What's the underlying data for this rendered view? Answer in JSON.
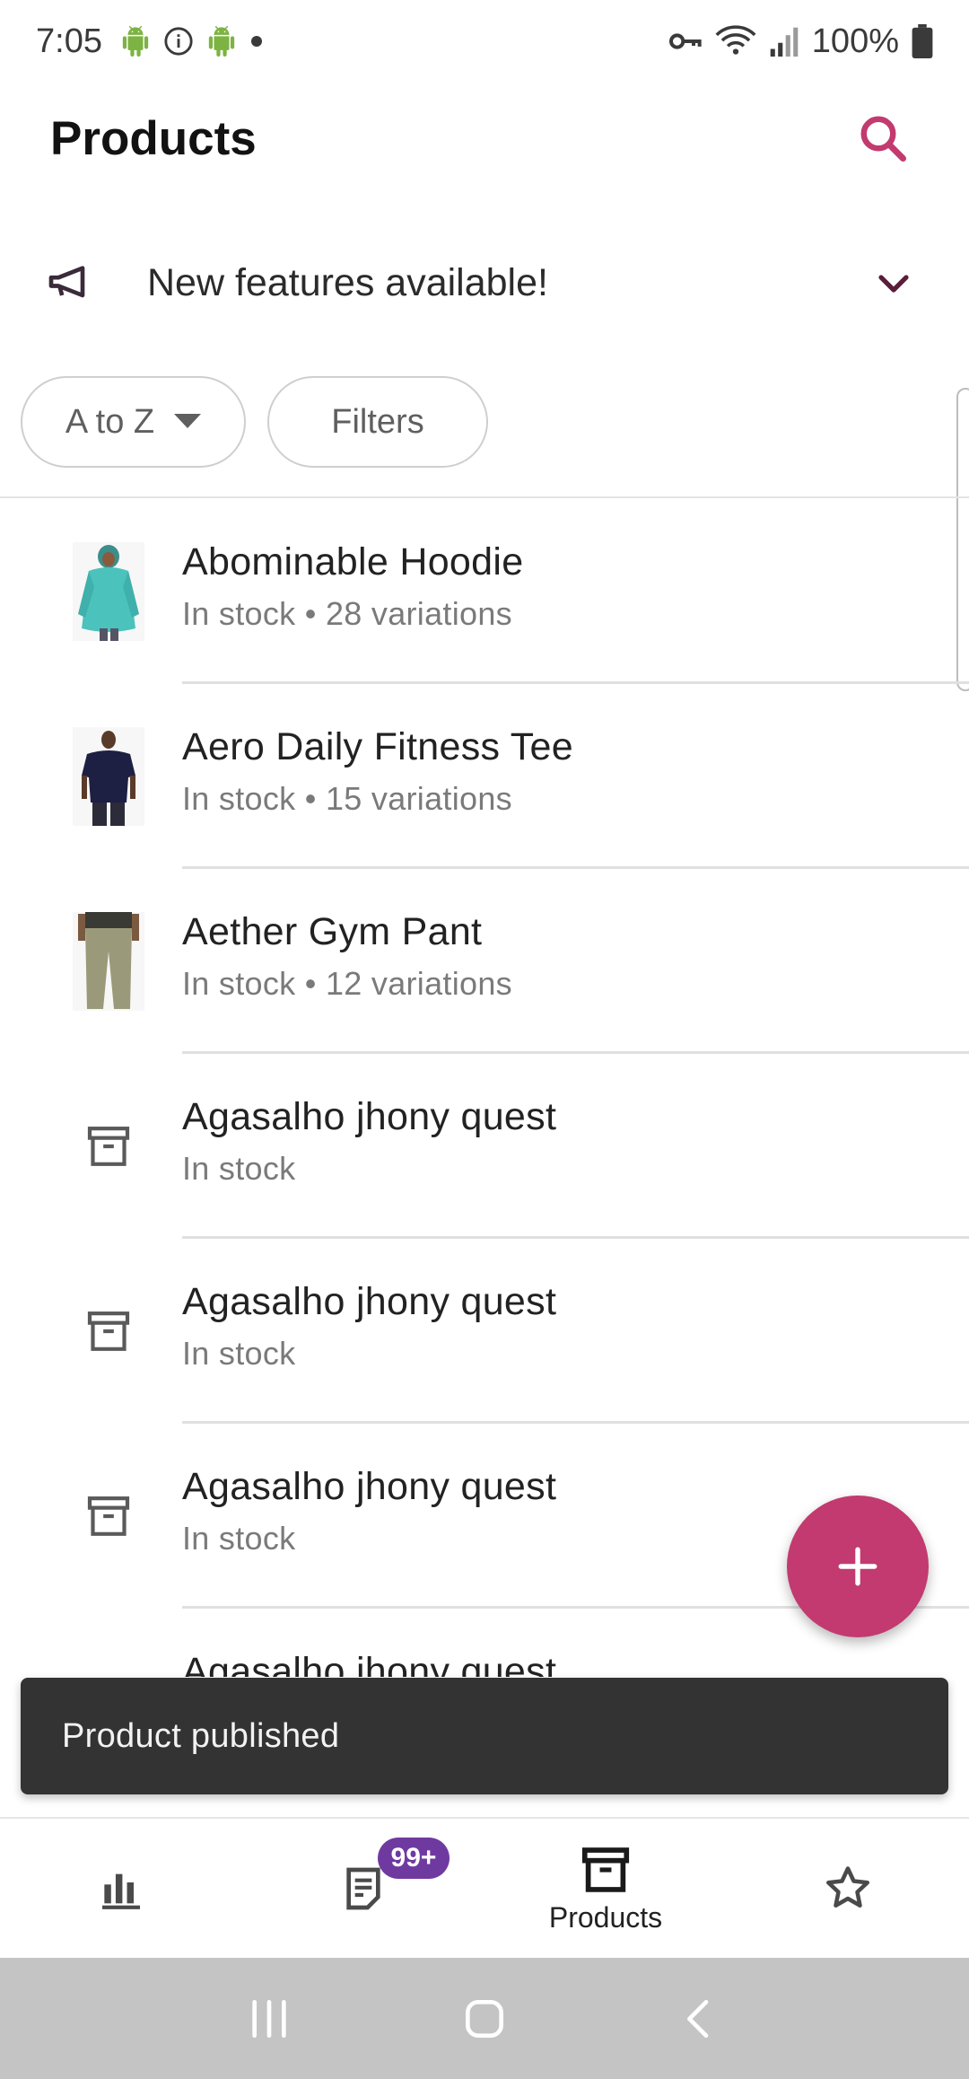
{
  "status_bar": {
    "time": "7:05",
    "battery": "100%"
  },
  "app_bar": {
    "title": "Products"
  },
  "feature_banner": {
    "text": "New features available!"
  },
  "chips": {
    "sort_label": "A to Z",
    "filters_label": "Filters"
  },
  "products": [
    {
      "name": "Abominable Hoodie",
      "meta": "In stock • 28 variations",
      "thumb": "hoodie"
    },
    {
      "name": "Aero Daily Fitness Tee",
      "meta": "In stock • 15 variations",
      "thumb": "tee"
    },
    {
      "name": "Aether Gym Pant",
      "meta": "In stock • 12 variations",
      "thumb": "pant"
    },
    {
      "name": "Agasalho jhony quest",
      "meta": "In stock",
      "thumb": "placeholder"
    },
    {
      "name": "Agasalho jhony quest",
      "meta": "In stock",
      "thumb": "placeholder"
    },
    {
      "name": "Agasalho jhony quest",
      "meta": "In stock",
      "thumb": "placeholder"
    },
    {
      "name": "Agasalho jhony quest",
      "meta": "",
      "thumb": "none"
    }
  ],
  "snackbar": {
    "message": "Product published"
  },
  "bottom_nav": {
    "orders_badge": "99+",
    "products_label": "Products"
  },
  "colors": {
    "accent": "#c23a6f",
    "badge": "#6f3aa0",
    "snackbar": "#333333",
    "system_nav": "#c4c4c4"
  },
  "icons": {
    "search": "search-icon",
    "megaphone": "megaphone-icon",
    "chevron": "chevron-down-icon",
    "sort_dropdown": "caret-down-icon",
    "placeholder": "archive-box-icon",
    "fab": "plus-icon",
    "nav_stats": "bar-chart-icon",
    "nav_orders": "orders-icon",
    "nav_products": "archive-box-icon",
    "nav_more": "star-icon"
  }
}
